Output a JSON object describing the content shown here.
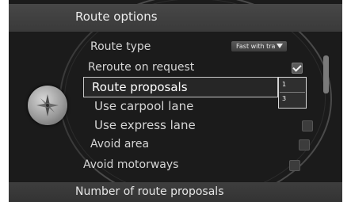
{
  "header": {
    "title": "Route options"
  },
  "rows": [
    {
      "label": "Route type",
      "control": "dropdown",
      "value": "Fast with tra"
    },
    {
      "label": "Reroute on request",
      "control": "checkbox",
      "checked": true
    },
    {
      "label": "Route proposals",
      "control": "selected"
    },
    {
      "label": "Use carpool lane",
      "control": "checkbox",
      "checked": false
    },
    {
      "label": "Use express lane",
      "control": "checkbox",
      "checked": false
    },
    {
      "label": "Avoid area",
      "control": "checkbox",
      "checked": false
    },
    {
      "label": "Avoid motorways",
      "control": "checkbox",
      "checked": false
    }
  ],
  "popup": {
    "items": [
      "1",
      "3"
    ]
  },
  "footer": {
    "title": "Number of route proposals"
  },
  "compass_icon": "compass-icon"
}
